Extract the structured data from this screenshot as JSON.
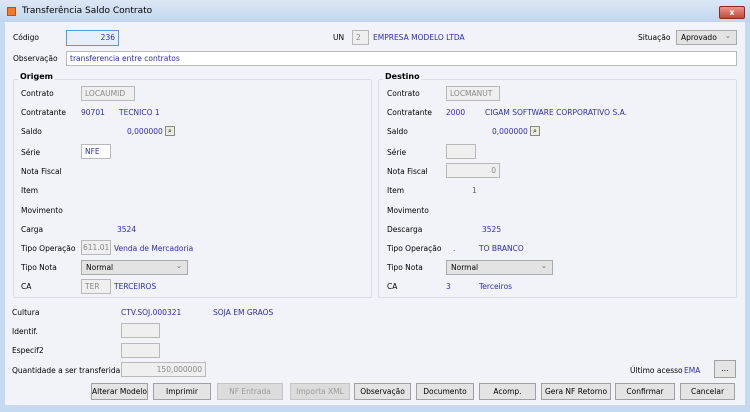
{
  "window": {
    "title": "Transferência Saldo Contrato",
    "close": "x"
  },
  "header": {
    "codigo_label": "Código",
    "codigo": "236",
    "un_label": "UN",
    "un": "2",
    "empresa": "EMPRESA MODELO LTDA",
    "situacao_label": "Situação",
    "situacao": "Aprovado",
    "observacao_label": "Observação",
    "observacao": "transferencia entre contratos"
  },
  "origem": {
    "title": "Origem",
    "contrato_label": "Contrato",
    "contrato": "LOCAUMID",
    "contratante_label": "Contratante",
    "contratante_code": "90701",
    "contratante_name": "TECNICO 1",
    "saldo_label": "Saldo",
    "saldo": "0,000000",
    "serie_label": "Série",
    "serie": "NFE",
    "nota_label": "Nota Fiscal",
    "item_label": "Item",
    "movimento_label": "Movimento",
    "carga_label": "Carga",
    "carga": "3524",
    "tipo_op_label": "Tipo Operação",
    "tipo_op_code": "611.01",
    "tipo_op_name": "Venda de Mercadoria",
    "tipo_nota_label": "Tipo Nota",
    "tipo_nota": "Normal",
    "ca_label": "CA",
    "ca_code": "TER",
    "ca_name": "TERCEIROS"
  },
  "destino": {
    "title": "Destino",
    "contrato_label": "Contrato",
    "contrato": "LOCMANUT",
    "contratante_label": "Contratante",
    "contratante_code": "2000",
    "contratante_name": "CIGAM SOFTWARE CORPORATIVO S.A.",
    "saldo_label": "Saldo",
    "saldo": "0,000000",
    "serie_label": "Série",
    "serie": "",
    "nota_label": "Nota Fiscal",
    "nota": "0",
    "item_label": "Item",
    "item": "1",
    "movimento_label": "Movimento",
    "descarga_label": "Descarga",
    "descarga": "3525",
    "tipo_op_label": "Tipo Operação",
    "tipo_op_code": ".",
    "tipo_op_name": "TO BRANCO",
    "tipo_nota_label": "Tipo Nota",
    "tipo_nota": "Normal",
    "ca_label": "CA",
    "ca_code": "3",
    "ca_name": "Terceiros"
  },
  "footer": {
    "cultura_label": "Cultura",
    "cultura_code": "CTV.SOJ.000321",
    "cultura_name": "SOJA EM GRAOS",
    "identif_label": "Identif.",
    "especif_label": "Especif2",
    "quantidade_label": "Quantidade a ser transferida",
    "quantidade": "150,000000",
    "ultimo_label": "Último acesso",
    "ultimo": "EMA",
    "more": "..."
  },
  "buttons": [
    {
      "label": "Alterar Modelo"
    },
    {
      "label": "Imprimir"
    },
    {
      "label": "NF Entrada"
    },
    {
      "label": "Importa XML"
    },
    {
      "label": "Observação"
    },
    {
      "label": "Documento"
    },
    {
      "label": "Acomp."
    },
    {
      "label": "Gera NF Retorno"
    },
    {
      "label": "Confirmar"
    },
    {
      "label": "Cancelar"
    }
  ]
}
